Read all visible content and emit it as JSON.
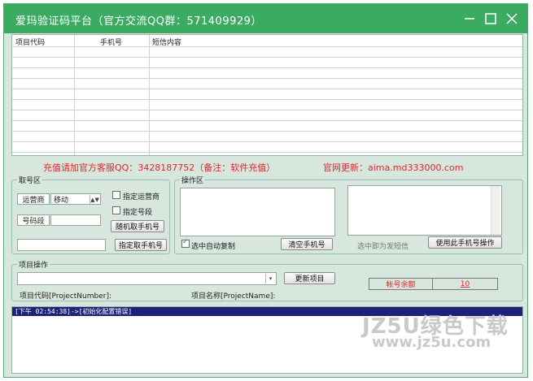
{
  "window": {
    "title": "爱玛验证码平台（官方交流QQ群：571409929）"
  },
  "grid": {
    "columns": [
      "项目代码",
      "手机号",
      "短信内容"
    ],
    "rows": []
  },
  "notices": {
    "recharge": "充值请加官方客服QQ：3428187752（备注：软件充值）",
    "website": "官网更新：aima.md333000.com"
  },
  "get_number": {
    "legend": "取号区",
    "carrier_label": "运营商",
    "carrier_value": "移动",
    "segment_label": "号码段",
    "segment_value": "",
    "specify_carrier_label": "指定运营商",
    "specify_segment_label": "指定号段",
    "random_button": "随机取手机号",
    "specify_input_value": "",
    "specify_button": "指定取手机号"
  },
  "operation": {
    "legend": "操作区",
    "auto_copy_label": "选中自动复制",
    "clear_button": "清空手机号",
    "select_hint": "选中即为发短信",
    "use_number_button": "使用此手机号操作"
  },
  "project": {
    "legend": "项目操作",
    "update_button": "更新项目",
    "code_label": "项目代码[ProjectNumber]:",
    "name_label": "项目名称[ProjectName]:",
    "balance_label": "帐号余额",
    "balance_value": "10"
  },
  "log": {
    "lines": [
      "[下午 02:54:38]->[初始化配置错误]"
    ]
  },
  "watermark": {
    "logo": "JZ5U绿色下载",
    "url": "www.jz5u.com"
  },
  "colors": {
    "titlebar": "#3bab62",
    "window_bg": "#d8e7de",
    "notice_red": "#e0262a",
    "log_highlight": "#1c2277"
  }
}
